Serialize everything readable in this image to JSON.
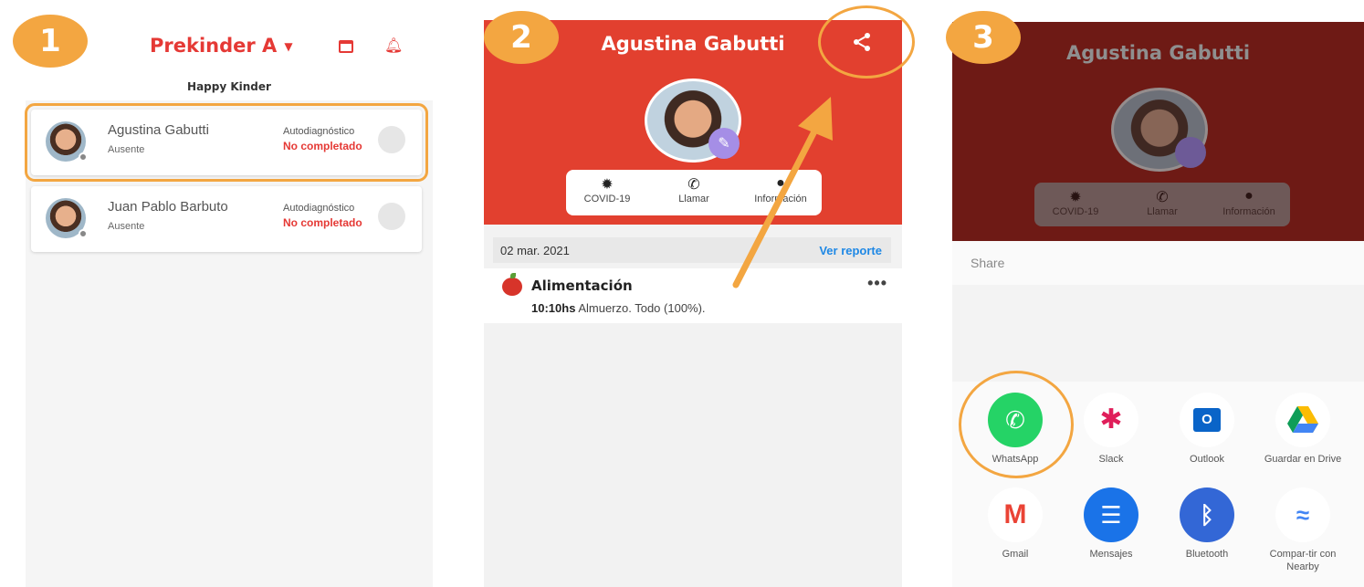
{
  "steps": [
    "1",
    "2",
    "3"
  ],
  "panel1": {
    "title": "Prekinder A",
    "subtitle": "Happy Kinder",
    "students": [
      {
        "name": "Agustina  Gabutti",
        "status": "Ausente",
        "auto": "Autodiagnóstico",
        "result": "No completado"
      },
      {
        "name": "Juan Pablo Barbuto",
        "status": "Ausente",
        "auto": "Autodiagnóstico",
        "result": "No completado"
      }
    ]
  },
  "panel2": {
    "name": "Agustina  Gabutti",
    "actions": [
      "COVID-19",
      "Llamar",
      "Información"
    ],
    "date": "02 mar. 2021",
    "report_link": "Ver reporte",
    "entry": {
      "title": "Alimentación",
      "time": "10:10hs",
      "text": "Almuerzo. Todo (100%).",
      "more": "•••"
    }
  },
  "panel3": {
    "name": "Agustina  Gabutti",
    "actions": [
      "COVID-19",
      "Llamar",
      "Información"
    ],
    "share_label": "Share",
    "apps": [
      {
        "name": "WhatsApp",
        "color": "#25d366",
        "icon": "whatsapp-icon"
      },
      {
        "name": "Slack",
        "color": "#ffffff",
        "icon": "slack-icon"
      },
      {
        "name": "Outlook",
        "color": "#ffffff",
        "icon": "outlook-icon"
      },
      {
        "name": "Guardar en Drive",
        "color": "#ffffff",
        "icon": "drive-icon"
      },
      {
        "name": "Gmail",
        "color": "#ffffff",
        "icon": "gmail-icon"
      },
      {
        "name": "Mensajes",
        "color": "#1a73e8",
        "icon": "messages-icon"
      },
      {
        "name": "Bluetooth",
        "color": "#3367d6",
        "icon": "bluetooth-icon"
      },
      {
        "name": "Compar-tir con Nearby",
        "color": "#ffffff",
        "icon": "nearby-icon"
      }
    ]
  },
  "colors": {
    "accent": "#e2402f",
    "highlight": "#f3a641",
    "alert_text": "#e53935",
    "link": "#1e88e5"
  }
}
